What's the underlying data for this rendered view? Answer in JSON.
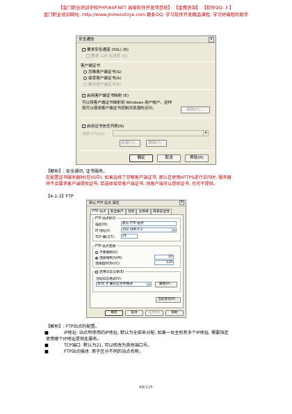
{
  "header": {
    "line1": "【金门职业培训学校PHP/ASP.NET 高级软件开发项目班】 【金鹰咨询】 【软件QQ: 3 】",
    "line2": "金门职业培训网址: http://www.jinmenzhiye.com  联系QQ: 学习软件开发精品课程, 学习好编程的助手"
  },
  "dialog1": {
    "title": "安全通信",
    "close": "×",
    "require_ssl": "要求安全通道 (SSL) (R)",
    "require_128": "要求 128 位加密 (Q)",
    "client_cert_group": "客户端证书",
    "radio_ignore": "忽略客户端证书(G)",
    "radio_accept": "接受客户端证书(A)",
    "radio_require": "要求客户端证书(E)",
    "enable_mapping": "启用客户端证书映射 (E)",
    "mapping_desc1": "可以将客户端证书映射到 Windows 用户帐户。这样",
    "mapping_desc2": "就可以使用客户端证书控制对资源的访问。",
    "edit_btn": "编辑(D)...",
    "enable_ctl": "启用证书信任列表(N)",
    "current_ctl_label": "当前 CTL(U):",
    "new_btn": "新建(U)...",
    "edit2_btn": "编辑(T)...",
    "ok": "确定",
    "cancel": "取消",
    "help": "帮助(H)"
  },
  "analysis1": {
    "line1": "【解析】: 安全通讯, 证书服务。",
    "line2": "在配置证书服务器时(在IIS中), 如果选择了忽略客户端证书, 那么在使用HTTPS进行访问时, 服务器",
    "line3": "将不会要求客户端提供证书; 若选择接受客户端证书, 则客户端可以提供证书, 也可不提供。"
  },
  "section_heading": "【4-1-3】FTP",
  "dialog2": {
    "title": "默认 FTP 站点 属性",
    "close": "×",
    "tabs": [
      "FTP 站点",
      "安全帐户",
      "消息",
      "主目录",
      "目录安全性"
    ],
    "group_ident": "FTP 站点标识",
    "desc_label": "描述(D):",
    "desc_value": "默认 FTP 站点",
    "ip_label": "IP 地址(I):",
    "ip_value": "192.168.0.2",
    "port_label": "TCP 端口(T):",
    "port_value": "21",
    "group_conn": "FTP 站点连接",
    "unlimited": "不受限制(U)",
    "limited": "连接限制为(M):",
    "limited_value": "10",
    "timeout_label": "连接超时(秒)(C):",
    "timeout_value": "120",
    "enable_log": "启用日志记录(E)",
    "active_log_label": "活动日志格式(V):",
    "log_format": "W3C 扩展日志文件格式",
    "props_btn": "属性(P)...",
    "sessions_btn": "当前会话(R)...",
    "ok": "确定",
    "cancel": "取消",
    "apply": "应用(A)",
    "help": "帮助"
  },
  "analysis2": {
    "heading": "【解析】: FTP站点的配置。",
    "b1": "IP地址: 站点所使用的IP地址, 默认为全部未分配, 如果一台主机有多个IP地址, 需要指定",
    "b1c": "使用哪个IP地址提供此服务。",
    "b2k": "TCP端口:",
    "b2v": "默认为21, 可以修改为其他端口号。",
    "b3k": "FTP站点描述:",
    "b3v": "用于区分不同的站点名称。",
    "bullet": "■"
  },
  "page_number": "88/125"
}
